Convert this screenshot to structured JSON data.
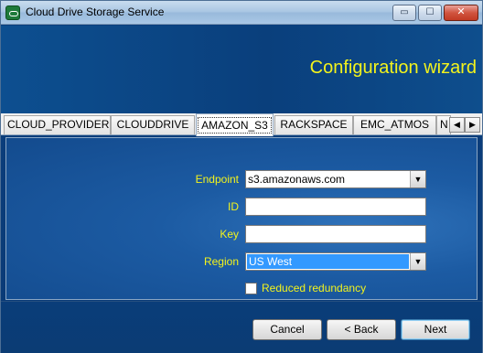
{
  "window": {
    "title": "Cloud Drive Storage Service",
    "controls": {
      "minimize": "▭",
      "maximize": "☐",
      "close": "✕"
    }
  },
  "header": {
    "title": "Configuration wizard"
  },
  "tabs": [
    {
      "label": "CLOUD_PROVIDER",
      "active": false
    },
    {
      "label": "CLOUDDRIVE",
      "active": false
    },
    {
      "label": "AMAZON_S3",
      "active": true
    },
    {
      "label": "RACKSPACE",
      "active": false
    },
    {
      "label": "EMC_ATMOS",
      "active": false
    },
    {
      "label": "N",
      "active": false
    }
  ],
  "tab_scroll": {
    "left": "◀",
    "right": "▶"
  },
  "form": {
    "endpoint": {
      "label": "Endpoint",
      "value": "s3.amazonaws.com"
    },
    "id": {
      "label": "ID",
      "value": ""
    },
    "key": {
      "label": "Key",
      "value": ""
    },
    "region": {
      "label": "Region",
      "value": "US West"
    },
    "reduced_redundancy": {
      "label": "Reduced redundancy",
      "checked": false
    }
  },
  "buttons": {
    "cancel": "Cancel",
    "back": "< Back",
    "next": "Next"
  },
  "colors": {
    "accent_text": "#f3f31c",
    "background": "#0b3f7e",
    "selection": "#3399ff"
  }
}
